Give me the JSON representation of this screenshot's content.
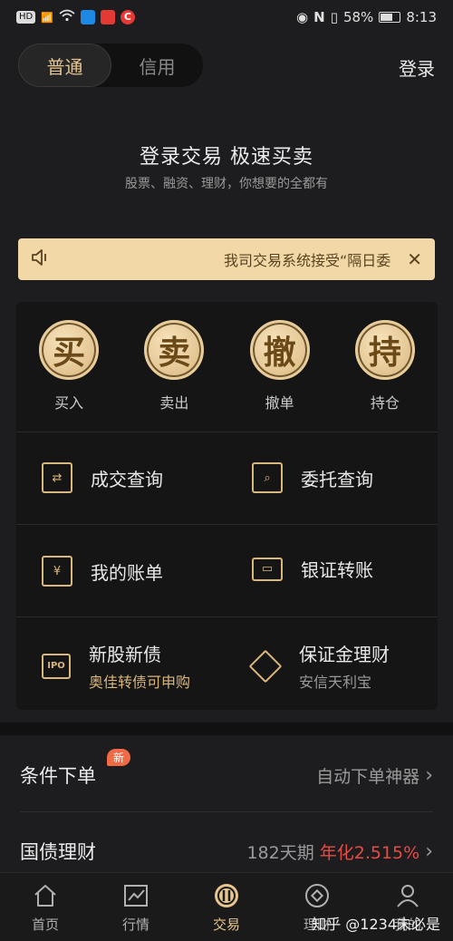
{
  "status_bar": {
    "left_chips": [
      "HD",
      "4G",
      "⁴⁶"
    ],
    "battery": "58%",
    "time": "8:13"
  },
  "header": {
    "tabs": [
      {
        "label": "普通",
        "active": true
      },
      {
        "label": "信用",
        "active": false
      }
    ],
    "login": "登录"
  },
  "hero": {
    "title": "登录交易 极速买卖",
    "subtitle": "股票、融资、理财，你想要的全都有"
  },
  "notice": {
    "text": "我司交易系统接受“隔日委",
    "close": "✕"
  },
  "quick_actions": [
    {
      "glyph": "买",
      "label": "买入"
    },
    {
      "glyph": "卖",
      "label": "卖出"
    },
    {
      "glyph": "撤",
      "label": "撤单"
    },
    {
      "glyph": "持",
      "label": "持仓"
    }
  ],
  "menu": {
    "trade_query": "成交查询",
    "order_query": "委托查询",
    "bill": "我的账单",
    "bank_transfer": "银证转账",
    "ipo": {
      "title": "新股新债",
      "subtitle": "奥佳转债可申购",
      "icon_text": "IPO"
    },
    "margin_wealth": {
      "title": "保证金理财",
      "subtitle": "安信天利宝"
    }
  },
  "conditional_order": {
    "title": "条件下单",
    "badge": "新",
    "right": "自动下单神器"
  },
  "bonds": {
    "title": "国债理财",
    "term": "182天期",
    "rate": "年化2.515%"
  },
  "tabbar": [
    {
      "label": "首页",
      "icon": "home-icon"
    },
    {
      "label": "行情",
      "icon": "chart-icon"
    },
    {
      "label": "交易",
      "icon": "trade-icon",
      "active": true
    },
    {
      "label": "理财",
      "icon": "wealth-icon"
    },
    {
      "label": "我的",
      "icon": "user-icon"
    }
  ],
  "watermark": "知乎 @1234未必是",
  "colors": {
    "gold": "#d9b67b",
    "notice_bg": "#f1d8a6",
    "red": "#e84a44",
    "bg": "#1d1d1f"
  }
}
